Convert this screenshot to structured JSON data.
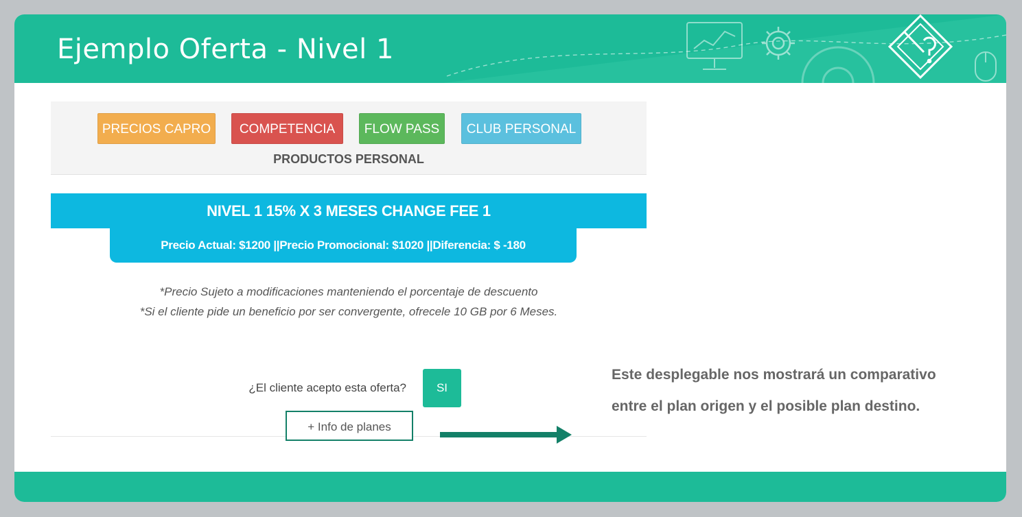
{
  "slide": {
    "title": "Ejemplo Oferta - Nivel 1",
    "colors": {
      "accent": "#1dbb98",
      "banner": "#0db8e0",
      "box_border": "#138068"
    }
  },
  "header_icons": [
    "monitor-chart-icon",
    "gear-icon",
    "large-gear-icon",
    "pencil-question-icon",
    "mouse-icon"
  ],
  "app": {
    "buttons": {
      "precios": "PRECIOS CAPRO",
      "competencia": "COMPETENCIA",
      "flow": "FLOW PASS",
      "club": "CLUB PERSONAL"
    },
    "products_title": "PRODUCTOS PERSONAL",
    "nivel_banner": "NIVEL 1 15% X 3 MESES CHANGE FEE 1",
    "price_bar": "Precio Actual: $1200 ||Precio Promocional: $1020 ||Diferencia: $ -180",
    "note1": "*Precio Sujeto a modificaciones manteniendo el porcentaje de descuento",
    "note2": "*Si el cliente pide un beneficio por ser convergente, ofrecele 10 GB por 6 Meses.",
    "question": "¿El cliente acepto esta oferta?",
    "si_button": "SI",
    "info_planes": "+ Info de planes"
  },
  "explanation": "Este desplegable nos mostrará un comparativo entre el plan origen y el posible plan destino."
}
